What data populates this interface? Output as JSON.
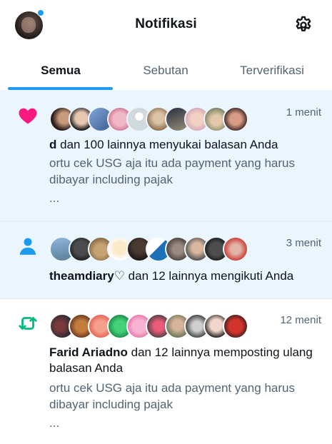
{
  "header": {
    "title": "Notifikasi",
    "profile_icon": "profile-avatar",
    "settings_icon": "gear-icon",
    "unread_dot_color": "#1d9bf0"
  },
  "tabs": [
    {
      "label": "Semua",
      "active": true
    },
    {
      "label": "Sebutan",
      "active": false
    },
    {
      "label": "Terverifikasi",
      "active": false
    }
  ],
  "notifications": [
    {
      "type": "like",
      "icon": "heart-icon",
      "icon_color": "#f91880",
      "time": "1 menit",
      "actor": "d",
      "action": " dan 100 lainnya menyukai balasan Anda",
      "preview": "ortu cek USG aja itu ada payment yang harus dibayar including pajak",
      "ellipsis": "...",
      "unread": true
    },
    {
      "type": "follow",
      "icon": "person-icon",
      "icon_color": "#1d9bf0",
      "time": "3 menit",
      "actor": "theamdiary♡",
      "action": " dan 12 lainnya mengikuti Anda",
      "unread": true
    },
    {
      "type": "repost",
      "icon": "repost-icon",
      "icon_color": "#00ba7c",
      "time": "12 menit",
      "actor": "Farid Ariadno",
      "action": " dan 12 lainnya memposting ulang balasan Anda",
      "preview": "ortu cek USG aja itu ada payment yang harus dibayar including pajak",
      "ellipsis": "...",
      "unread": false
    }
  ]
}
